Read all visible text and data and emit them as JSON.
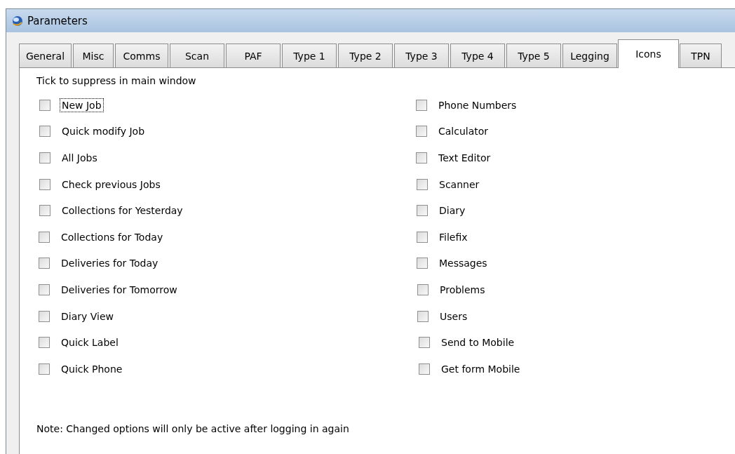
{
  "window": {
    "title": "Parameters"
  },
  "tabs": [
    {
      "label": "General",
      "selected": false
    },
    {
      "label": "Misc",
      "selected": false
    },
    {
      "label": "Comms",
      "selected": false
    },
    {
      "label": "Scan",
      "selected": false
    },
    {
      "label": "PAF",
      "selected": false
    },
    {
      "label": "Type 1",
      "selected": false
    },
    {
      "label": "Type 2",
      "selected": false
    },
    {
      "label": "Type 3",
      "selected": false
    },
    {
      "label": "Type 4",
      "selected": false
    },
    {
      "label": "Type 5",
      "selected": false
    },
    {
      "label": "Legging",
      "selected": false
    },
    {
      "label": "Icons",
      "selected": true
    },
    {
      "label": "TPN",
      "selected": false
    }
  ],
  "heading": "Tick to suppress in main window",
  "columns": [
    [
      {
        "label": "New Job",
        "checked": false,
        "focused": true
      },
      {
        "label": "Quick modify Job",
        "checked": false,
        "focused": false
      },
      {
        "label": "All Jobs",
        "checked": false,
        "focused": false
      },
      {
        "label": "Check previous Jobs",
        "checked": false,
        "focused": false
      },
      {
        "label": "Collections for Yesterday",
        "checked": false,
        "focused": false
      },
      {
        "label": "Collections for Today",
        "checked": false,
        "focused": false
      },
      {
        "label": "Deliveries for Today",
        "checked": false,
        "focused": false
      },
      {
        "label": "Deliveries for Tomorrow",
        "checked": false,
        "focused": false
      },
      {
        "label": "Diary View",
        "checked": false,
        "focused": false
      },
      {
        "label": "Quick Label",
        "checked": false,
        "focused": false
      },
      {
        "label": "Quick Phone",
        "checked": false,
        "focused": false
      }
    ],
    [
      {
        "label": "Phone Numbers",
        "checked": false,
        "focused": false
      },
      {
        "label": "Calculator",
        "checked": false,
        "focused": false
      },
      {
        "label": "Text Editor",
        "checked": false,
        "focused": false
      },
      {
        "label": "Scanner",
        "checked": false,
        "focused": false
      },
      {
        "label": "Diary",
        "checked": false,
        "focused": false
      },
      {
        "label": "Filefix",
        "checked": false,
        "focused": false
      },
      {
        "label": "Messages",
        "checked": false,
        "focused": false
      },
      {
        "label": "Problems",
        "checked": false,
        "focused": false
      },
      {
        "label": "Users",
        "checked": false,
        "focused": false
      },
      {
        "label": "Send to Mobile",
        "checked": false,
        "focused": false
      },
      {
        "label": "Get form Mobile",
        "checked": false,
        "focused": false
      }
    ]
  ],
  "note": "Note: Changed options will only be active after logging in again"
}
